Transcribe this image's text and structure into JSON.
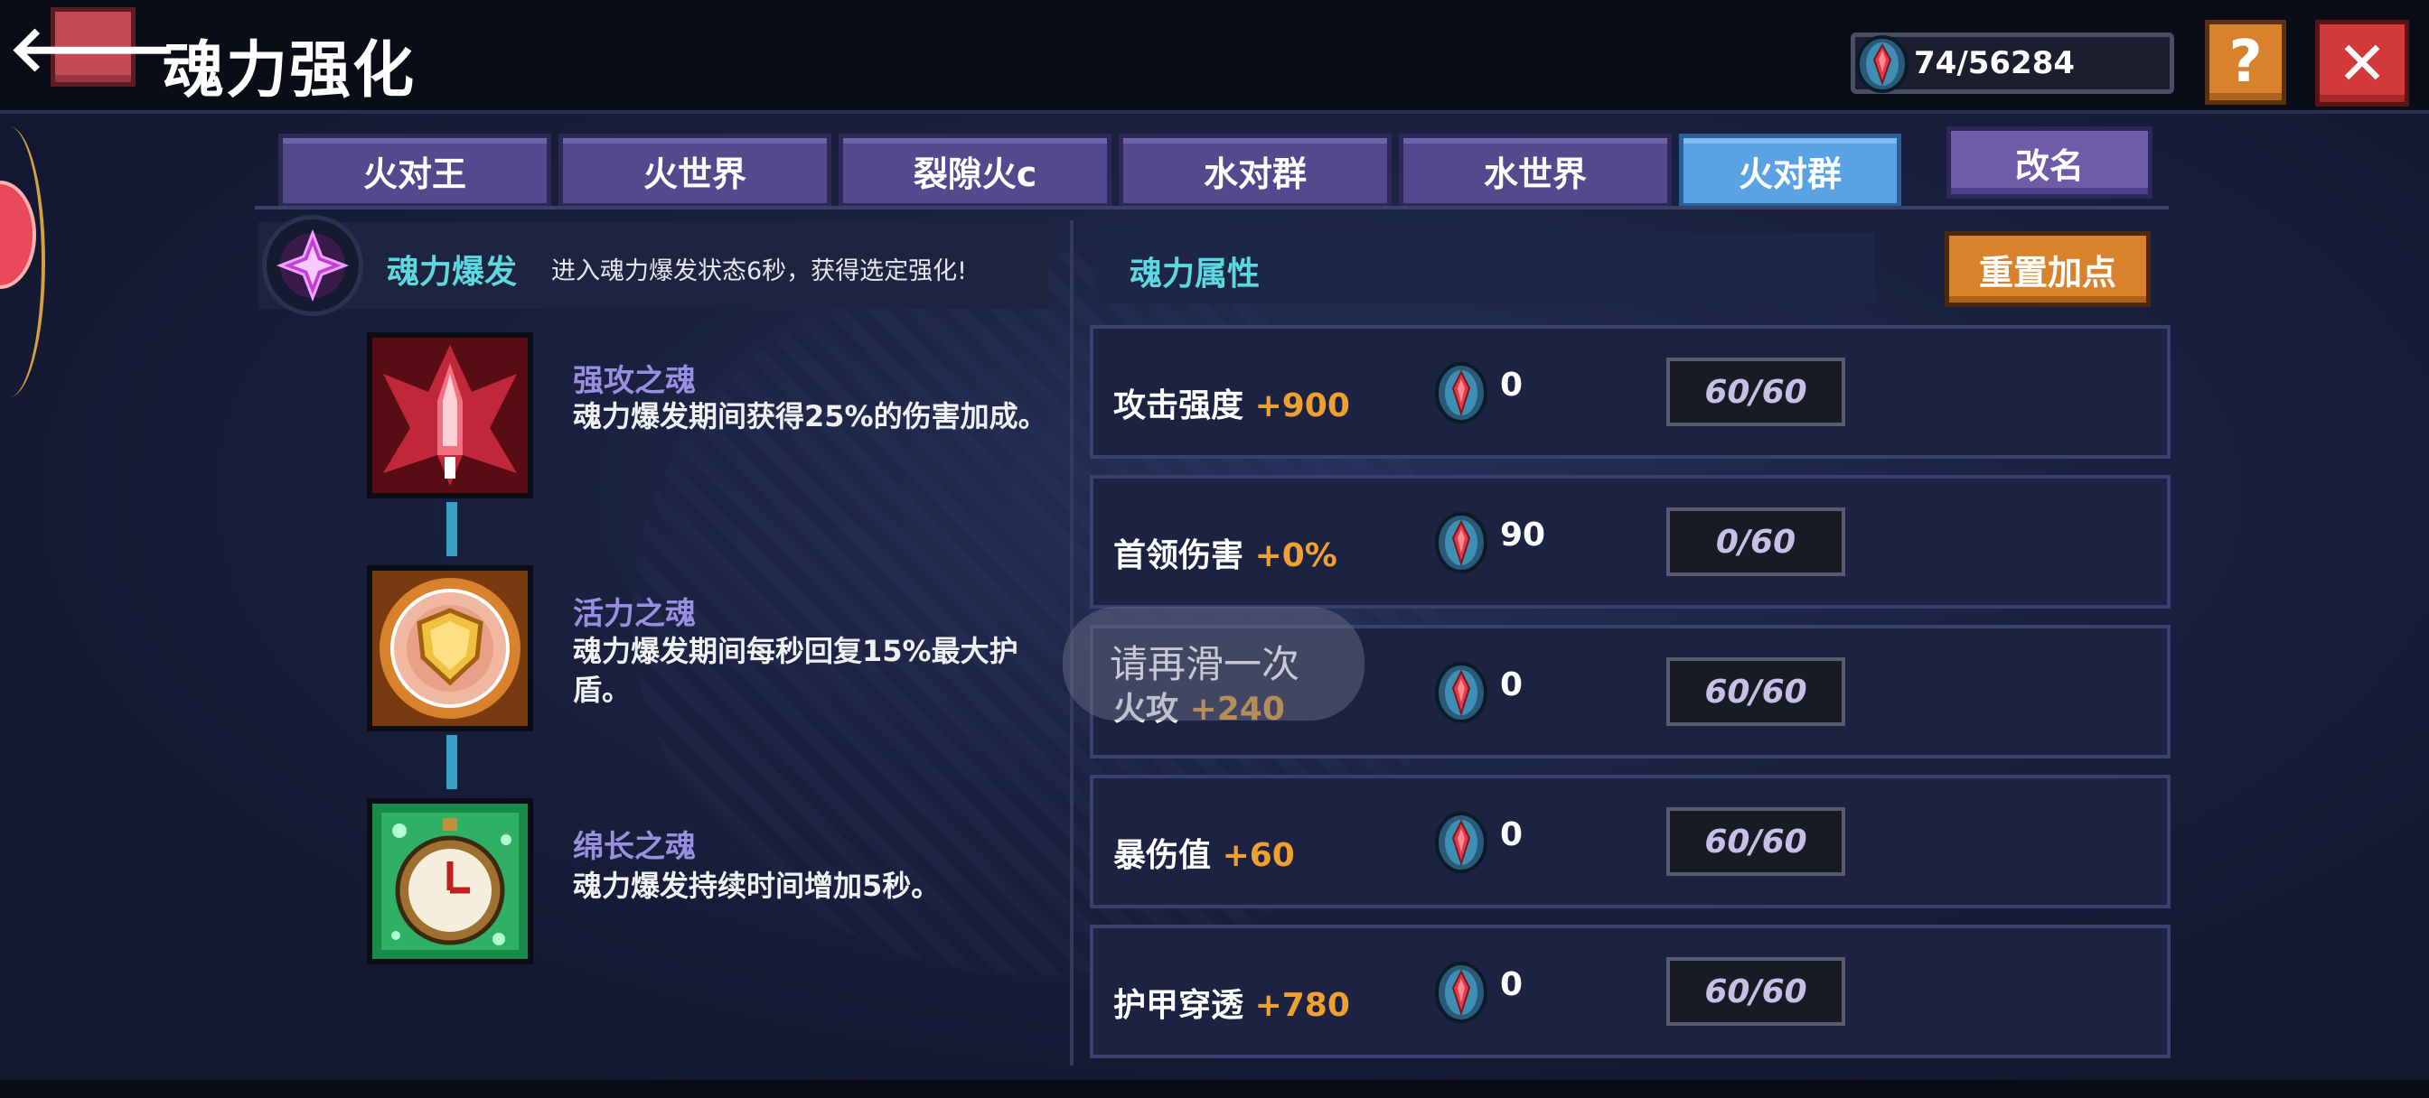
{
  "header": {
    "back_glyph": "🡐",
    "title": "魂力强化",
    "currency": "74/56284",
    "help_glyph": "?",
    "close_glyph": "✕"
  },
  "tabs": [
    {
      "label": "火对王",
      "active": false
    },
    {
      "label": "火世界",
      "active": false
    },
    {
      "label": "裂隙火c",
      "active": false
    },
    {
      "label": "水对群",
      "active": false
    },
    {
      "label": "水世界",
      "active": false
    },
    {
      "label": "火对群",
      "active": true
    }
  ],
  "rename_label": "改名",
  "burst": {
    "title": "魂力爆发",
    "description": "进入魂力爆发状态6秒，获得选定强化!"
  },
  "skills": [
    {
      "name": "强攻之魂",
      "description": "魂力爆发期间获得25%的伤害加成。",
      "icon": "red-ship-icon"
    },
    {
      "name": "活力之魂",
      "description": "魂力爆发期间每秒回复15%最大护盾。",
      "icon": "shield-icon"
    },
    {
      "name": "绵长之魂",
      "description": "魂力爆发持续时间增加5秒。",
      "icon": "stopwatch-icon"
    }
  ],
  "attributes": {
    "title": "魂力属性",
    "reset_label": "重置加点",
    "rows": [
      {
        "label": "攻击强度",
        "bonus": "+900",
        "cost": "0",
        "level": "60/60"
      },
      {
        "label": "首领伤害",
        "bonus": "+0%",
        "cost": "90",
        "level": "0/60"
      },
      {
        "label": "火攻",
        "bonus": "+240",
        "cost": "0",
        "level": "60/60"
      },
      {
        "label": "暴伤值",
        "bonus": "+60",
        "cost": "0",
        "level": "60/60"
      },
      {
        "label": "护甲穿透",
        "bonus": "+780",
        "cost": "0",
        "level": "60/60"
      }
    ]
  },
  "toast": "请再滑一次",
  "colors": {
    "accent_cyan": "#5ed8e0",
    "bonus_orange": "#f0a030",
    "tab_purple": "#524a8c",
    "tab_active_blue": "#5aa2e4",
    "button_orange": "#d9822e",
    "close_red": "#d23a3a"
  }
}
